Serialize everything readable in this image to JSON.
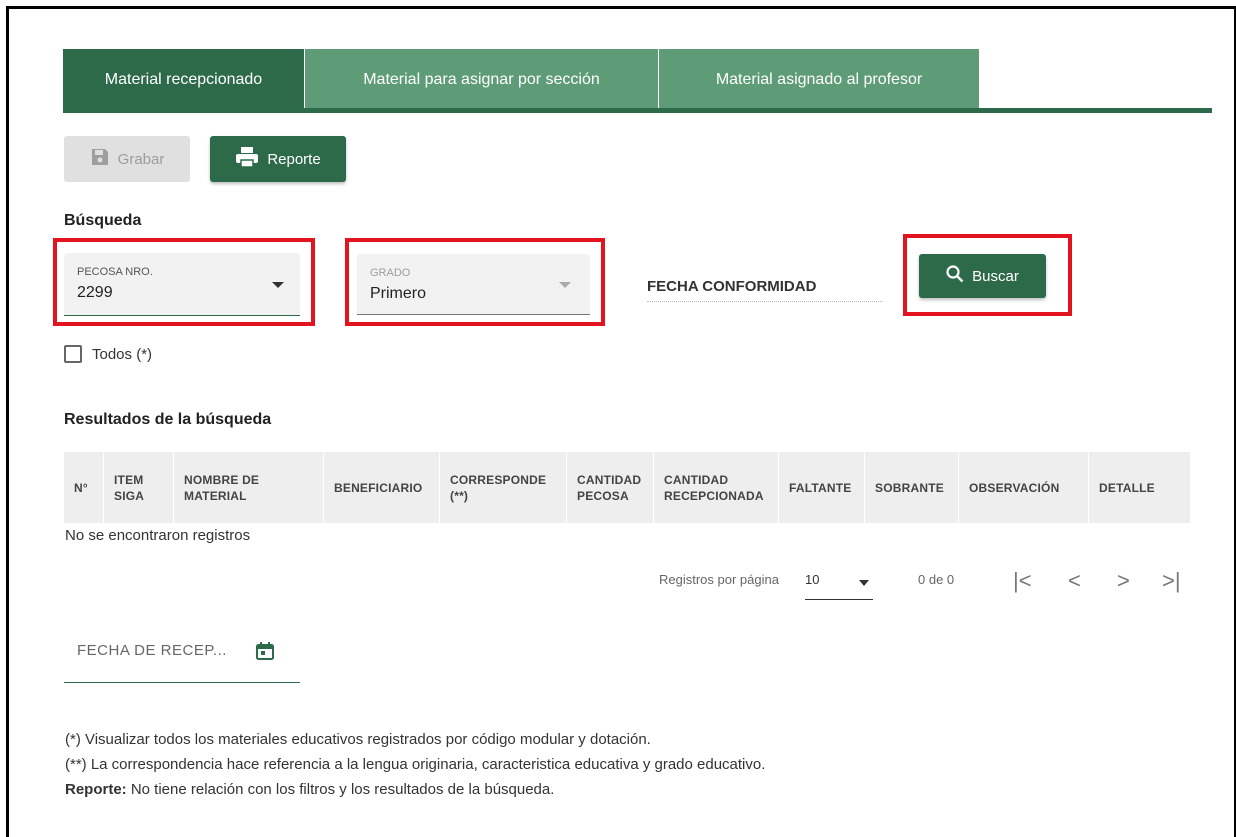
{
  "tabs": [
    {
      "label": "Material recepcionado"
    },
    {
      "label": "Material para asignar por sección"
    },
    {
      "label": "Material asignado al profesor"
    }
  ],
  "toolbar": {
    "grabar_label": "Grabar",
    "reporte_label": "Reporte"
  },
  "search": {
    "title": "Búsqueda",
    "pecosa": {
      "label": "PECOSA NRO.",
      "value": "2299"
    },
    "grado": {
      "label": "GRADO",
      "value": "Primero"
    },
    "fecha_conformidad_label": "FECHA CONFORMIDAD",
    "buscar_label": "Buscar",
    "todos_label": "Todos (*)"
  },
  "results": {
    "title": "Resultados de la búsqueda",
    "columns": [
      {
        "key": "n",
        "lines": [
          "N°",
          ""
        ]
      },
      {
        "key": "item_siga",
        "lines": [
          "ITEM",
          "SIGA"
        ]
      },
      {
        "key": "nombre",
        "lines": [
          "NOMBRE DE",
          "MATERIAL"
        ]
      },
      {
        "key": "beneficiario",
        "lines": [
          "BENEFICIARIO",
          ""
        ]
      },
      {
        "key": "corresponde",
        "lines": [
          "CORRESPONDE",
          "(**)"
        ]
      },
      {
        "key": "cant_pecosa",
        "lines": [
          "CANTIDAD",
          "PECOSA"
        ]
      },
      {
        "key": "cant_recep",
        "lines": [
          "CANTIDAD",
          "RECEPCIONADA"
        ]
      },
      {
        "key": "faltante",
        "lines": [
          "FALTANTE",
          ""
        ]
      },
      {
        "key": "sobrante",
        "lines": [
          "SOBRANTE",
          ""
        ]
      },
      {
        "key": "observacion",
        "lines": [
          "OBSERVACIÓN",
          ""
        ]
      },
      {
        "key": "detalle",
        "lines": [
          "DETALLE",
          ""
        ]
      }
    ],
    "empty_text": "No se encontraron registros"
  },
  "pagination": {
    "per_page_label": "Registros por página",
    "per_page_value": "10",
    "range_text": "0 de 0",
    "first_icon": "|<",
    "prev_icon": "<",
    "next_icon": ">",
    "last_icon": ">|"
  },
  "fecha_recepcion_label": "FECHA DE RECEP...",
  "notes": {
    "note1": "(*) Visualizar todos los materiales educativos registrados por código modular y dotación.",
    "note2": "(**) La correspondencia hace referencia a la lengua originaria, caracteristica educativa y grado educativo.",
    "note3_bold": "Reporte:",
    "note3_text": " No tiene relación con los filtros y los resultados de la búsqueda."
  },
  "colors": {
    "primary": "#2d6a4a",
    "tab_inactive": "#5e9c77",
    "highlight": "#e3141f"
  }
}
